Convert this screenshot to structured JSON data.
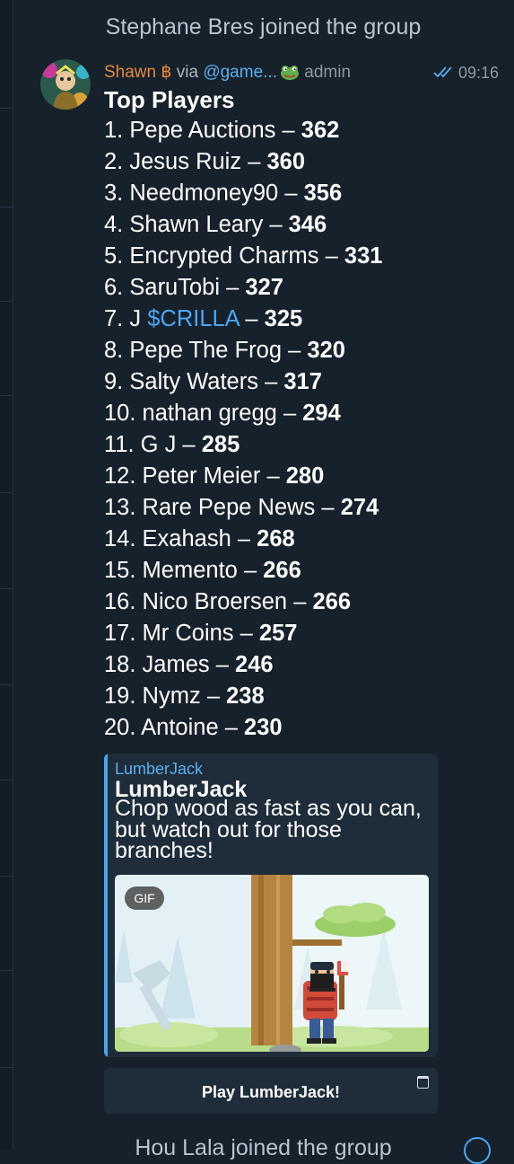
{
  "service_top": "Stephane Bres joined the group",
  "service_bottom": "Hou Lala joined the group",
  "message": {
    "sender": "Shawn ฿",
    "via_label": "via",
    "bot": "@game...",
    "role": "admin",
    "time": "09:16",
    "title": "Top Players",
    "players": [
      {
        "rank": "1.",
        "name": "Pepe Auctions",
        "score": "362"
      },
      {
        "rank": "2.",
        "name": "Jesus Ruiz",
        "score": "360"
      },
      {
        "rank": "3.",
        "name": "Needmoney90",
        "score": "356"
      },
      {
        "rank": "4.",
        "name": "Shawn Leary",
        "score": "346"
      },
      {
        "rank": "5.",
        "name": "Encrypted Charms",
        "score": "331"
      },
      {
        "rank": "6.",
        "name": "SaruTobi",
        "score": "327"
      },
      {
        "rank": "7.",
        "name_prefix": "J",
        "name_link": "$CRILLA",
        "score": "325"
      },
      {
        "rank": "8.",
        "name": "Pepe The Frog",
        "score": "320"
      },
      {
        "rank": "9.",
        "name": "Salty Waters",
        "score": "317"
      },
      {
        "rank": "10.",
        "name": "nathan gregg",
        "score": "294"
      },
      {
        "rank": "11.",
        "name": "G J",
        "score": "285"
      },
      {
        "rank": "12.",
        "name": "Peter Meier",
        "score": "280"
      },
      {
        "rank": "13.",
        "name": "Rare Pepe News",
        "score": "274"
      },
      {
        "rank": "14.",
        "name": "Exahash",
        "score": "268"
      },
      {
        "rank": "15.",
        "name": "Memento",
        "score": "266"
      },
      {
        "rank": "16.",
        "name": "Nico Broersen",
        "score": "266"
      },
      {
        "rank": "17.",
        "name": "Mr Coins",
        "score": "257"
      },
      {
        "rank": "18.",
        "name": "James",
        "score": "246"
      },
      {
        "rank": "19.",
        "name": "Nymz",
        "score": "238"
      },
      {
        "rank": "20.",
        "name": "Antoine",
        "score": "230"
      }
    ],
    "dash": "–"
  },
  "game": {
    "site_name": "LumberJack",
    "title": "LumberJack",
    "description": "Chop wood as fast as you can, but watch out for those branches!",
    "media_badge": "GIF"
  },
  "play_button": {
    "label": "Play LumberJack!"
  },
  "icons": {
    "read_receipt": "double-check-icon",
    "admin_badge": "frog-icon",
    "open_app": "open-app-icon"
  },
  "colors": {
    "background": "#17212b",
    "sender": "#e8873d",
    "link": "#4aa6f3",
    "card": "#1f2c3a"
  }
}
